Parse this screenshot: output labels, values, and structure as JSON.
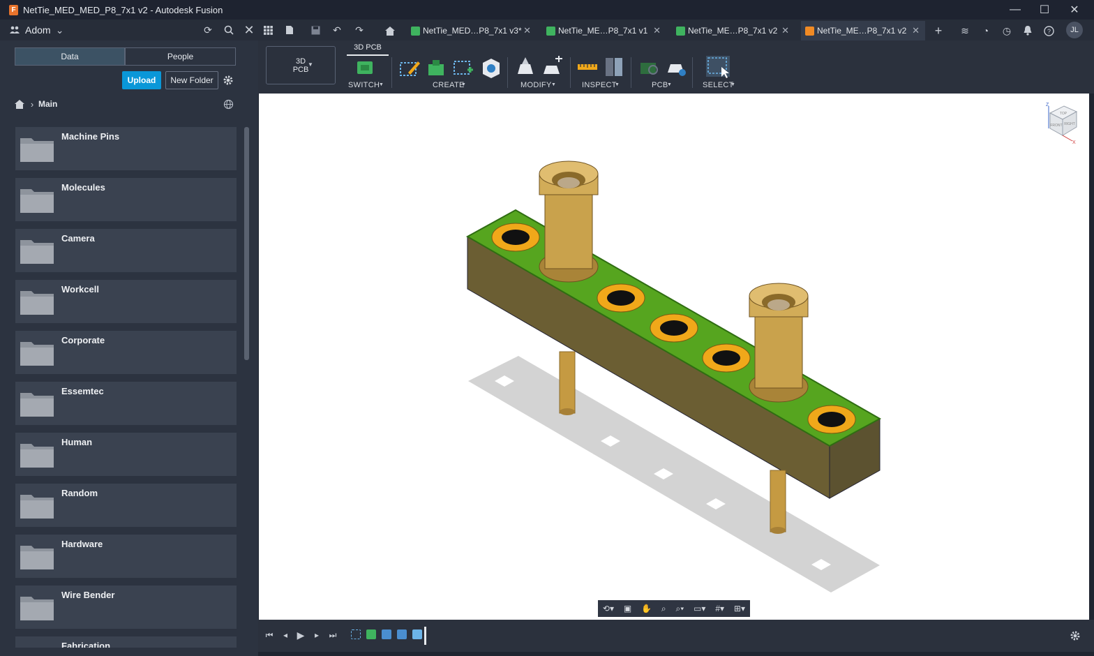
{
  "window": {
    "title": "NetTie_MED_MED_P8_7x1 v2 - Autodesk Fusion",
    "controls": {
      "minimize": "—",
      "maximize": "☐",
      "close": "✕"
    }
  },
  "topbar": {
    "team_name": "Adom",
    "user_initials": "JL"
  },
  "tabs": [
    {
      "label": "NetTie_MED…P8_7x1 v3*",
      "icon_color": "#3fb35f"
    },
    {
      "label": "NetTie_ME…P8_7x1 v1",
      "icon_color": "#3fb35f"
    },
    {
      "label": "NetTie_ME…P8_7x1 v2",
      "icon_color": "#3fb35f"
    },
    {
      "label": "NetTie_ME…P8_7x1 v2",
      "icon_color": "#f08a24"
    }
  ],
  "sidebar": {
    "segment": {
      "data": "Data",
      "people": "People"
    },
    "upload": "Upload",
    "new_folder": "New Folder",
    "breadcrumb": "Main",
    "folders": [
      "Machine Pins",
      "Molecules",
      "Camera",
      "Workcell",
      "Corporate",
      "Essemtec",
      "Human",
      "Random",
      "Hardware",
      "Wire Bender",
      "Fabrication"
    ]
  },
  "toolbar": {
    "workspace": {
      "line1": "3D",
      "line2": "PCB"
    },
    "active_tab": "3D PCB",
    "groups": {
      "switch": "SWITCH",
      "create": "CREATE",
      "modify": "MODIFY",
      "inspect": "INSPECT",
      "pcb": "PCB",
      "select": "SELECT"
    }
  },
  "viewcube": {
    "top": "TOP",
    "front": "FRONT",
    "right": "RIGHT",
    "axis_z": "Z",
    "axis_x": "X"
  },
  "colors": {
    "accent": "#0a97d8",
    "pcb_green": "#56a51f",
    "brass": "#c9a24c",
    "pad_gold": "#f0a81a"
  }
}
